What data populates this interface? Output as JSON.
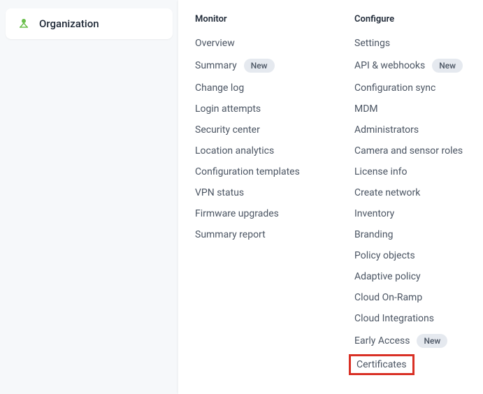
{
  "sidebar": {
    "item": {
      "label": "Organization",
      "icon": "organization-icon"
    }
  },
  "dropdown": {
    "monitor": {
      "header": "Monitor",
      "items": [
        {
          "label": "Overview",
          "badge": null
        },
        {
          "label": "Summary",
          "badge": "New"
        },
        {
          "label": "Change log",
          "badge": null
        },
        {
          "label": "Login attempts",
          "badge": null
        },
        {
          "label": "Security center",
          "badge": null
        },
        {
          "label": "Location analytics",
          "badge": null
        },
        {
          "label": "Configuration templates",
          "badge": null
        },
        {
          "label": "VPN status",
          "badge": null
        },
        {
          "label": "Firmware upgrades",
          "badge": null
        },
        {
          "label": "Summary report",
          "badge": null
        }
      ]
    },
    "configure": {
      "header": "Configure",
      "items": [
        {
          "label": "Settings",
          "badge": null,
          "highlighted": false
        },
        {
          "label": "API & webhooks",
          "badge": "New",
          "highlighted": false
        },
        {
          "label": "Configuration sync",
          "badge": null,
          "highlighted": false
        },
        {
          "label": "MDM",
          "badge": null,
          "highlighted": false
        },
        {
          "label": "Administrators",
          "badge": null,
          "highlighted": false
        },
        {
          "label": "Camera and sensor roles",
          "badge": null,
          "highlighted": false
        },
        {
          "label": "License info",
          "badge": null,
          "highlighted": false
        },
        {
          "label": "Create network",
          "badge": null,
          "highlighted": false
        },
        {
          "label": "Inventory",
          "badge": null,
          "highlighted": false
        },
        {
          "label": "Branding",
          "badge": null,
          "highlighted": false
        },
        {
          "label": "Policy objects",
          "badge": null,
          "highlighted": false
        },
        {
          "label": "Adaptive policy",
          "badge": null,
          "highlighted": false
        },
        {
          "label": "Cloud On-Ramp",
          "badge": null,
          "highlighted": false
        },
        {
          "label": "Cloud Integrations",
          "badge": null,
          "highlighted": false
        },
        {
          "label": "Early Access",
          "badge": "New",
          "highlighted": false
        },
        {
          "label": "Certificates",
          "badge": null,
          "highlighted": true
        }
      ]
    }
  }
}
